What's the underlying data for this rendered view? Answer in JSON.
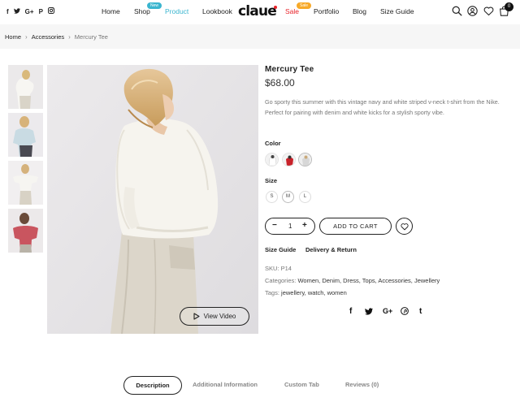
{
  "header": {
    "social_icons": [
      "facebook-icon",
      "twitter-icon",
      "google-plus-icon",
      "pinterest-icon",
      "instagram-icon"
    ],
    "nav": [
      {
        "label": "Home"
      },
      {
        "label": "Shop",
        "badge": "New"
      },
      {
        "label": "Product",
        "active": true
      },
      {
        "label": "Lookbook"
      },
      {
        "label": "Sale",
        "badge": "Sale"
      },
      {
        "label": "Portfolio"
      },
      {
        "label": "Blog"
      },
      {
        "label": "Size Guide"
      }
    ],
    "logo": "claue",
    "tools": [
      "search-icon",
      "user-icon",
      "heart-icon",
      "cart-icon"
    ],
    "cart_count": "0",
    "accent_color": "#3ab5cf",
    "sale_color": "#f7a928"
  },
  "breadcrumb": [
    "Home",
    "Accessories",
    "Mercury Tee"
  ],
  "gallery": {
    "thumb_count": 4,
    "video_label": "View Video"
  },
  "product": {
    "title": "Mercury Tee",
    "price": "$68.00",
    "description": "Go sporty this summer with this vintage navy and white striped v-neck t-shirt from the Nike. Perfect for pairing with denim and white kicks for a stylish sporty vibe.",
    "color_label": "Color",
    "colors": [
      "white",
      "red",
      "light-grey"
    ],
    "size_label": "Size",
    "sizes": [
      "S",
      "M",
      "L"
    ],
    "selected_size": "M",
    "quantity": "1",
    "add_to_cart": "ADD TO CART",
    "size_guide": "Size Guide",
    "delivery": "Delivery & Return",
    "sku_label": "SKU:",
    "sku": "P14",
    "categories_label": "Categories:",
    "categories": "Women, Denim, Dress, Tops, Accessories, Jewellery",
    "tags_label": "Tags:",
    "tags": "jewellery, watch, women",
    "share_icons": [
      "facebook-icon",
      "twitter-icon",
      "google-plus-icon",
      "pinterest-icon",
      "tumblr-icon"
    ]
  },
  "tabs": [
    {
      "label": "Description",
      "active": true
    },
    {
      "label": "Additional Information"
    },
    {
      "label": "Custom Tab"
    },
    {
      "label": "Reviews (0)"
    }
  ]
}
